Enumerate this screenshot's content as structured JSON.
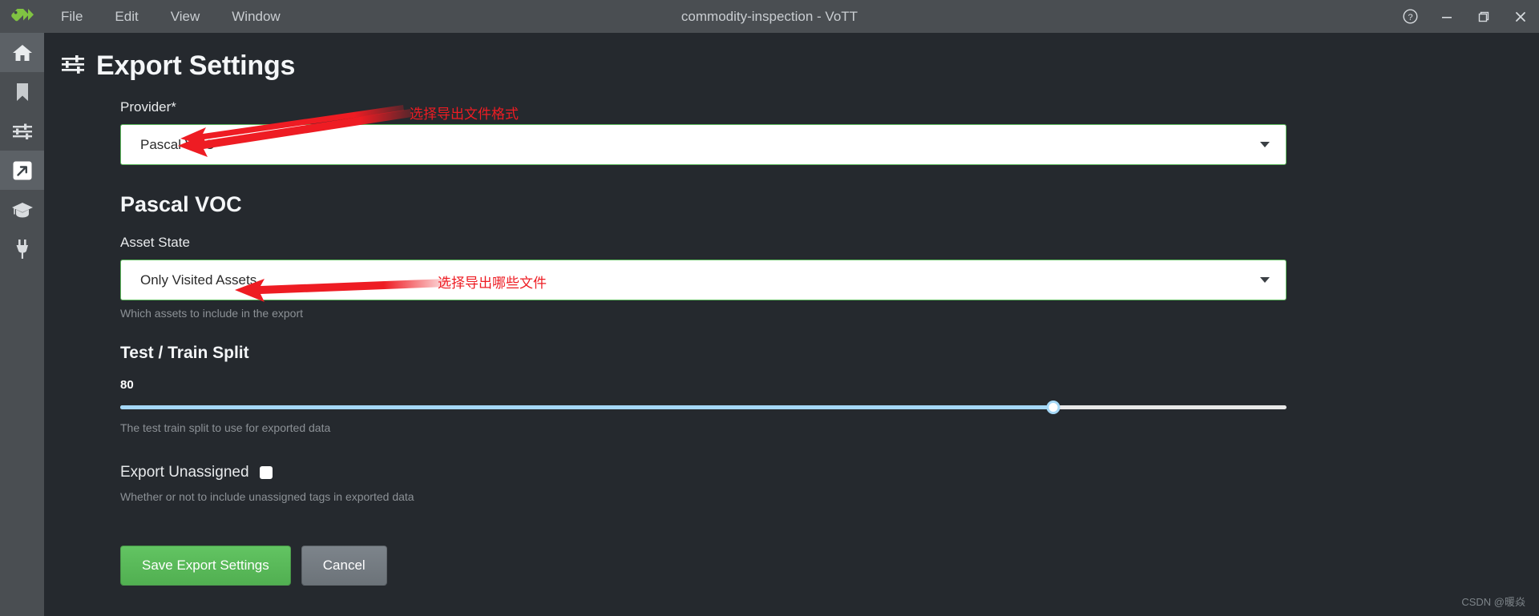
{
  "titlebar": {
    "logo_icon": "vott-tag-logo",
    "menus": [
      {
        "label": "File",
        "name": "menu-file"
      },
      {
        "label": "Edit",
        "name": "menu-edit"
      },
      {
        "label": "View",
        "name": "menu-view"
      },
      {
        "label": "Window",
        "name": "menu-window"
      }
    ],
    "title": "commodity-inspection - VoTT",
    "controls": [
      {
        "name": "help-icon",
        "glyph": "?"
      },
      {
        "name": "minimize-icon",
        "glyph": "—"
      },
      {
        "name": "restore-icon",
        "glyph": "❐"
      },
      {
        "name": "close-icon",
        "glyph": "✕"
      }
    ]
  },
  "sidebar": {
    "items": [
      {
        "name": "sidebar-item-home",
        "icon": "home-icon",
        "active": true
      },
      {
        "name": "sidebar-item-tags",
        "icon": "bookmark-icon",
        "active": false
      },
      {
        "name": "sidebar-item-settings",
        "icon": "sliders-icon",
        "active": false
      },
      {
        "name": "sidebar-item-export",
        "icon": "export-arrow-icon",
        "active": true
      },
      {
        "name": "sidebar-item-training",
        "icon": "graduation-cap-icon",
        "active": false
      },
      {
        "name": "sidebar-item-connections",
        "icon": "plug-icon",
        "active": false
      }
    ]
  },
  "page": {
    "title": "Export Settings",
    "title_icon": "sliders-icon"
  },
  "provider": {
    "label": "Provider*",
    "value": "Pascal VOC",
    "caret_icon": "chevron-down-icon"
  },
  "section": {
    "title": "Pascal VOC"
  },
  "asset_state": {
    "label": "Asset State",
    "value": "Only Visited Assets",
    "helper": "Which assets to include in the export",
    "caret_icon": "chevron-down-icon"
  },
  "split": {
    "label": "Test / Train Split",
    "value": "80",
    "percent": 80,
    "helper": "The test train split to use for exported data"
  },
  "unassigned": {
    "label": "Export Unassigned",
    "checked": false,
    "helper": "Whether or not to include unassigned tags in exported data"
  },
  "buttons": {
    "save_label": "Save Export Settings",
    "cancel_label": "Cancel"
  },
  "annotations": [
    {
      "name": "annotation-provider",
      "text": "选择导出文件格式"
    },
    {
      "name": "annotation-asset-state",
      "text": "选择导出哪些文件"
    }
  ],
  "watermark": "CSDN @暖焱",
  "colors": {
    "titlebar_bg": "#4a4e52",
    "sidebar_bg": "#4a4e52",
    "content_bg": "#25292e",
    "accent_green": "#5cb85c",
    "save_button": "#62c462",
    "cancel_button": "#7d848b",
    "slider_fill": "#a5d8f7",
    "annotation_red": "#ee1c23",
    "logo_green": "#80c342"
  }
}
